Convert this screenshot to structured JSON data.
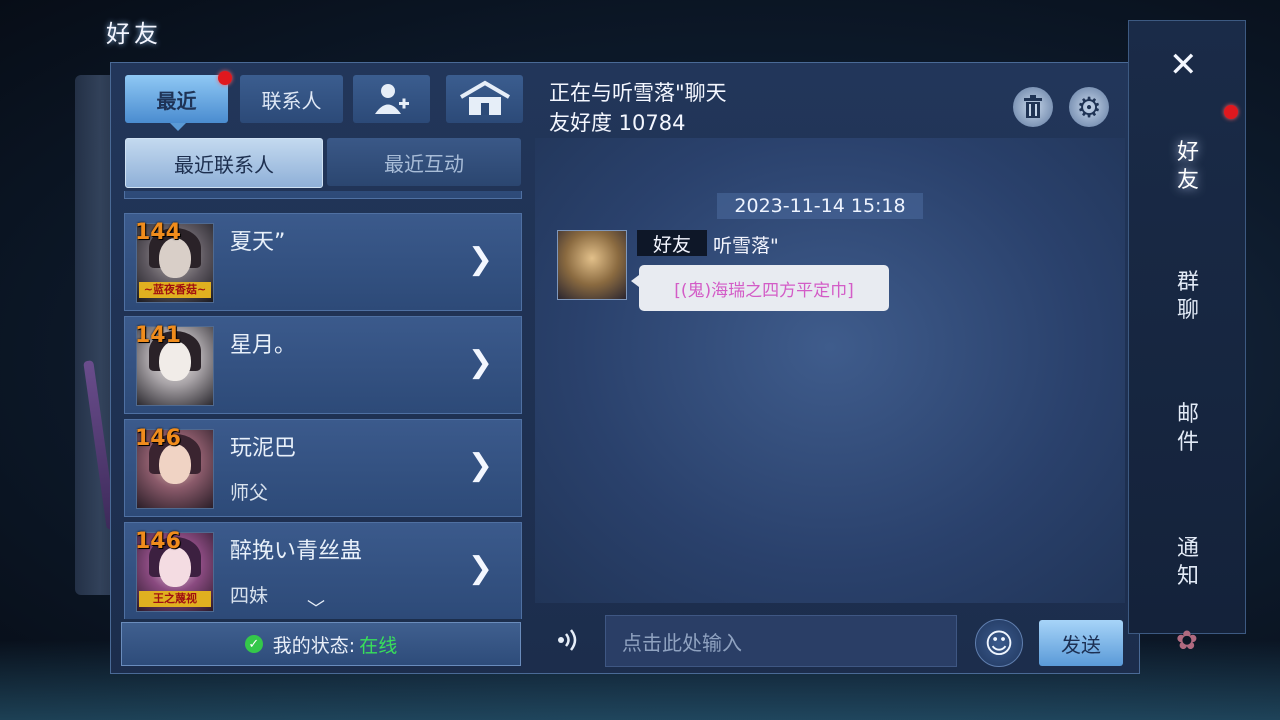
{
  "page": {
    "title": "好友"
  },
  "tabs": {
    "recent": "最近",
    "contacts": "联系人",
    "add_friend_icon": "add-user-icon",
    "home_icon": "home-icon"
  },
  "subtabs": {
    "recent_contacts": "最近联系人",
    "recent_interactions": "最近互动"
  },
  "friends": [
    {
      "level": "144",
      "name": "夏天”",
      "sub": "",
      "badge": "~蓝夜香菇~"
    },
    {
      "level": "141",
      "name": "星月。",
      "sub": "",
      "badge": ""
    },
    {
      "level": "146",
      "name": "玩泥巴",
      "sub": "师父",
      "badge": ""
    },
    {
      "level": "146",
      "name": "醉挽い青丝蛊",
      "sub": "四妹",
      "badge": "王之蔑视"
    }
  ],
  "status": {
    "label": "我的状态:",
    "value": "在线"
  },
  "chat": {
    "title": "正在与听雪落\"聊天",
    "friendship": "友好度 10784",
    "timestamp": "2023-11-14 15:18",
    "tag": "好友",
    "sender": "听雪落\"",
    "message": "[(鬼)海瑞之四方平定巾]",
    "input_placeholder": "点击此处输入",
    "send": "发送"
  },
  "rail": {
    "friends": "好友",
    "group_chat": "群聊",
    "mail": "邮件",
    "notice": "通知"
  },
  "colors": {
    "accent": "#8fc8f4",
    "online": "#38e05a",
    "level": "#f08c1c",
    "item_link": "#d35cc7"
  }
}
